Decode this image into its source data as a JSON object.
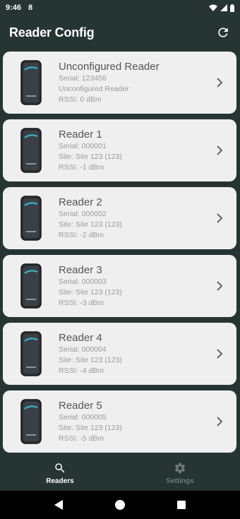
{
  "status_bar": {
    "time": "9:46",
    "notification": "8"
  },
  "app_bar": {
    "title": "Reader Config"
  },
  "readers": [
    {
      "title": "Unconfigured Reader",
      "serial": "Serial: 123456",
      "site": "Unconfigured Reader",
      "rssi": "RSSI: 0 dBm"
    },
    {
      "title": "Reader 1",
      "serial": "Serial: 000001",
      "site": "Site: Site 123 (123)",
      "rssi": "RSSI: -1 dBm"
    },
    {
      "title": "Reader 2",
      "serial": "Serial: 000002",
      "site": "Site: Site 123 (123)",
      "rssi": "RSSI: -2 dBm"
    },
    {
      "title": "Reader 3",
      "serial": "Serial: 000003",
      "site": "Site: Site 123 (123)",
      "rssi": "RSSI: -3 dBm"
    },
    {
      "title": "Reader 4",
      "serial": "Serial: 000004",
      "site": "Site: Site 123 (123)",
      "rssi": "RSSI: -4 dBm"
    },
    {
      "title": "Reader 5",
      "serial": "Serial: 000005",
      "site": "Site: Site 123 (123)",
      "rssi": "RSSI: -5 dBm"
    }
  ],
  "bottom_nav": {
    "readers_label": "Readers",
    "settings_label": "Settings"
  },
  "colors": {
    "background": "#263532",
    "card": "#efefef",
    "title_text": "#555555",
    "detail_text": "#9a9a9a",
    "accent": "#3fb0c4"
  },
  "icons": {
    "refresh": "refresh-icon",
    "chevron": "chevron-right-icon",
    "readers": "search-icon",
    "settings": "gear-icon"
  }
}
